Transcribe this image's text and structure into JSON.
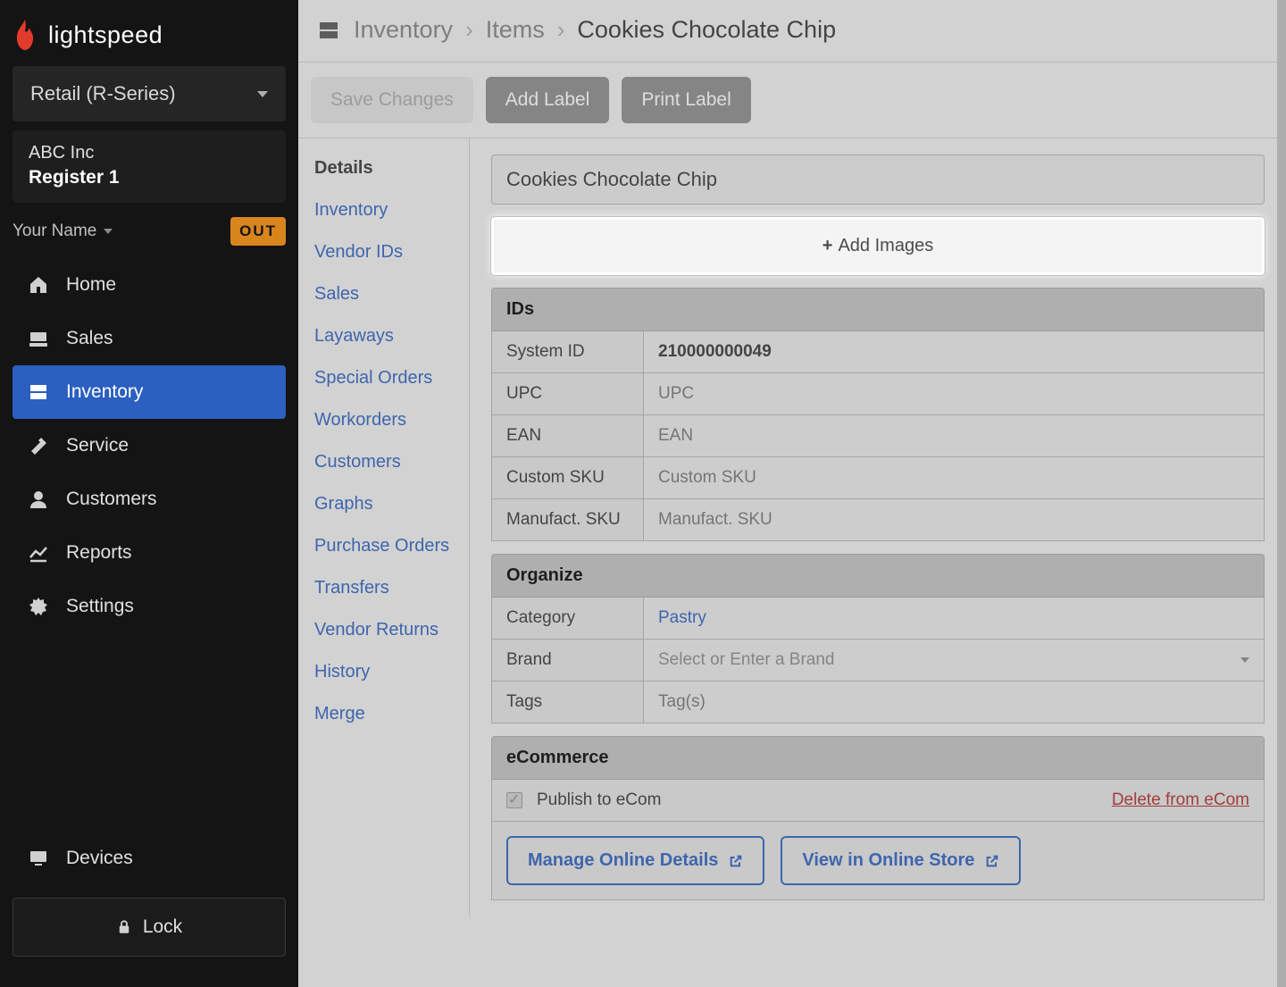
{
  "brand": {
    "name": "lightspeed"
  },
  "series": {
    "label": "Retail (R-Series)"
  },
  "register": {
    "company": "ABC Inc",
    "name": "Register 1"
  },
  "user": {
    "name": "Your Name",
    "status": "OUT"
  },
  "nav": {
    "home": "Home",
    "sales": "Sales",
    "inventory": "Inventory",
    "service": "Service",
    "customers": "Customers",
    "reports": "Reports",
    "settings": "Settings",
    "devices": "Devices",
    "lock": "Lock"
  },
  "breadcrumb": {
    "inventory": "Inventory",
    "items": "Items",
    "current": "Cookies Chocolate Chip"
  },
  "toolbar": {
    "save": "Save Changes",
    "add_label": "Add Label",
    "print_label": "Print Label"
  },
  "subnav": {
    "details": "Details",
    "inventory": "Inventory",
    "vendor_ids": "Vendor IDs",
    "sales": "Sales",
    "layaways": "Layaways",
    "special_orders": "Special Orders",
    "workorders": "Workorders",
    "customers": "Customers",
    "graphs": "Graphs",
    "purchase_orders": "Purchase Orders",
    "transfers": "Transfers",
    "vendor_returns": "Vendor Returns",
    "history": "History",
    "merge": "Merge"
  },
  "item": {
    "name": "Cookies Chocolate Chip",
    "add_images": "Add Images"
  },
  "ids": {
    "header": "IDs",
    "system_id_label": "System ID",
    "system_id": "210000000049",
    "upc_label": "UPC",
    "upc_placeholder": "UPC",
    "ean_label": "EAN",
    "ean_placeholder": "EAN",
    "custom_sku_label": "Custom SKU",
    "custom_sku_placeholder": "Custom SKU",
    "manufact_sku_label": "Manufact. SKU",
    "manufact_sku_placeholder": "Manufact. SKU"
  },
  "organize": {
    "header": "Organize",
    "category_label": "Category",
    "category_value": "Pastry",
    "brand_label": "Brand",
    "brand_placeholder": "Select or Enter a Brand",
    "tags_label": "Tags",
    "tags_placeholder": "Tag(s)"
  },
  "ecom": {
    "header": "eCommerce",
    "publish_label": "Publish to eCom",
    "delete_label": "Delete from eCom",
    "manage_label": "Manage Online Details",
    "view_label": "View in Online Store"
  }
}
